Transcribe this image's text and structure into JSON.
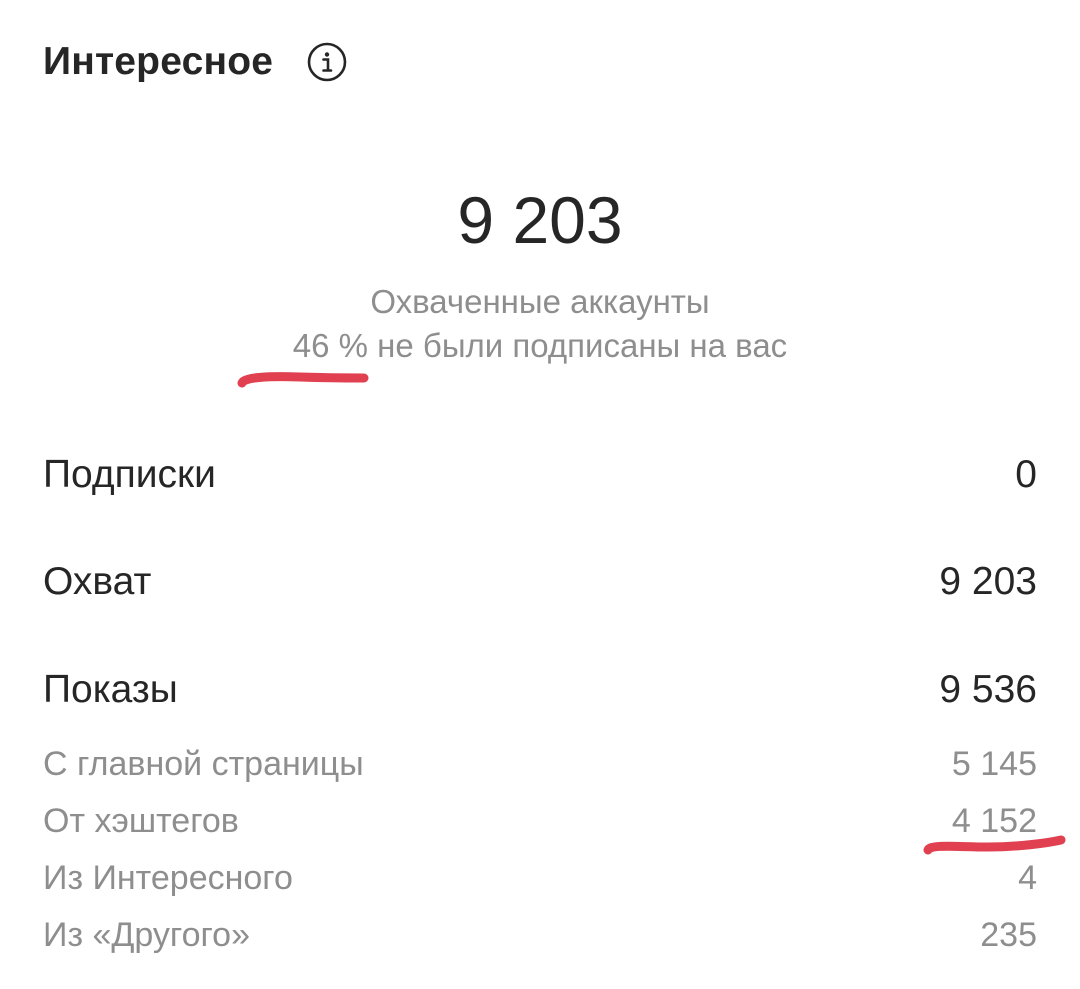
{
  "header": {
    "title": "Интересное",
    "info_icon": "info-circle-icon"
  },
  "summary": {
    "value": "9 203",
    "label": "Охваченные аккаунты",
    "sub_label": "46 % не были подписаны на вас"
  },
  "metrics": [
    {
      "label": "Подписки",
      "value": "0"
    },
    {
      "label": "Охват",
      "value": "9 203"
    },
    {
      "label": "Показы",
      "value": "9 536"
    }
  ],
  "impressions_breakdown": [
    {
      "label": "С главной страницы",
      "value": "5 145"
    },
    {
      "label": "От хэштегов",
      "value": "4 152"
    },
    {
      "label": "Из Интересного",
      "value": "4"
    },
    {
      "label": "Из «Другого»",
      "value": "235"
    }
  ],
  "colors": {
    "primary_text": "#262626",
    "secondary_text": "#8e8e8e",
    "annotation_marker": "#e0404f"
  }
}
